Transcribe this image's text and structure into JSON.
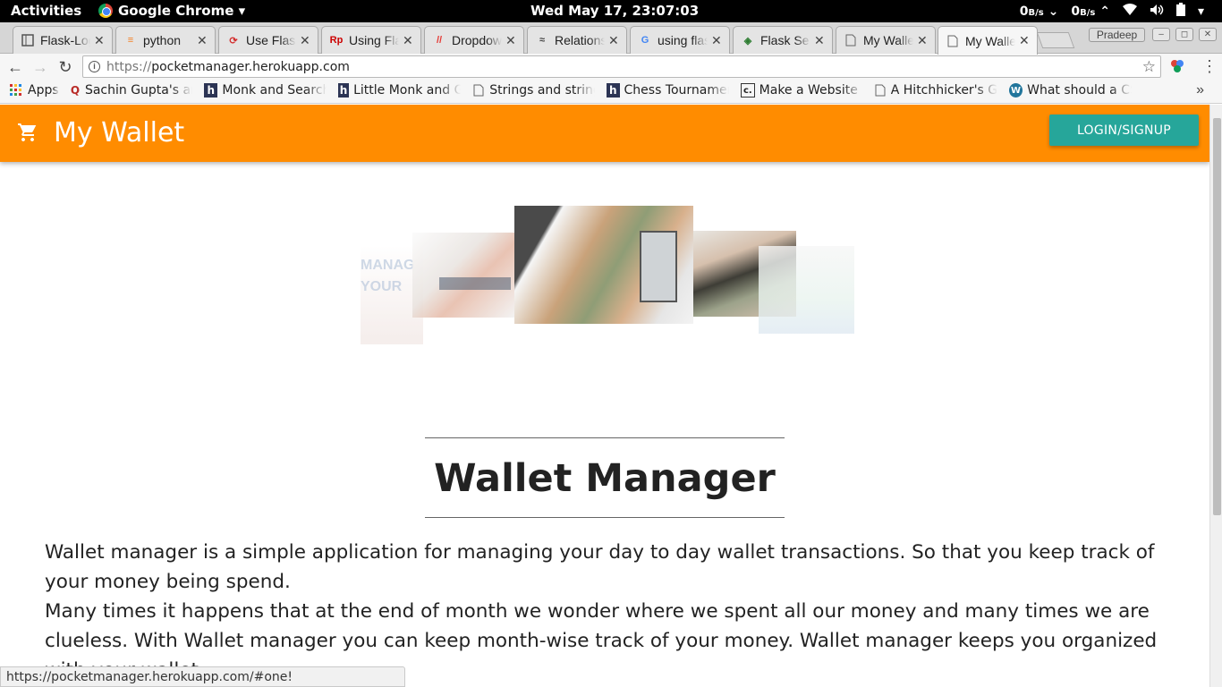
{
  "system": {
    "activities": "Activities",
    "app_name": "Google Chrome ▾",
    "clock": "Wed May 17, 23:07:03",
    "net_down": "0",
    "net_up": "0",
    "net_unit": "B/s",
    "user": "Pradeep"
  },
  "tabs": [
    {
      "label": "Flask-Login",
      "icon": "doc-icon"
    },
    {
      "label": "python",
      "icon": "stackoverflow-icon"
    },
    {
      "label": "Use Flask",
      "icon": "refresh-red-icon"
    },
    {
      "label": "Using Flask",
      "icon": "rp-icon"
    },
    {
      "label": "Dropdown",
      "icon": "materialize-icon"
    },
    {
      "label": "Relations",
      "icon": "sqlalchemy-icon"
    },
    {
      "label": "using flask",
      "icon": "google-icon"
    },
    {
      "label": "Flask Se",
      "icon": "flask-icon"
    },
    {
      "label": "My Wallet",
      "icon": "page-icon"
    },
    {
      "label": "My Wallet",
      "icon": "page-icon"
    }
  ],
  "omnibox": {
    "scheme": "https://",
    "host": "pocketmanager.herokuapp.com"
  },
  "bookmarks": [
    {
      "label": "Apps"
    },
    {
      "label": "Sachin Gupta's articles"
    },
    {
      "label": "Monk and Search"
    },
    {
      "label": "Little Monk and Goblet"
    },
    {
      "label": "Strings and strings"
    },
    {
      "label": "Chess Tournament"
    },
    {
      "label": "Make a Website |"
    },
    {
      "label": "A Hitchhicker's Guide"
    },
    {
      "label": "What should a CS"
    }
  ],
  "app": {
    "brand": "My Wallet",
    "login_button": "LOGIN/SIGNUP",
    "hero_alt_text": "MANAGE YOUR MONEY",
    "title": "Wallet Manager",
    "paragraph_1": "Wallet manager is a simple application for managing your day to day wallet transactions. So that you keep track of your money being spend.",
    "paragraph_2": "Many times it happens that at the end of month we wonder where we spent all our money and many times we are clueless. With Wallet manager you can keep month-wise track of your money. Wallet manager keeps you organized with your wallet."
  },
  "status_url": "https://pocketmanager.herokuapp.com/#one!",
  "colors": {
    "appbar": "#ff8c00",
    "login_button": "#26a69a"
  }
}
